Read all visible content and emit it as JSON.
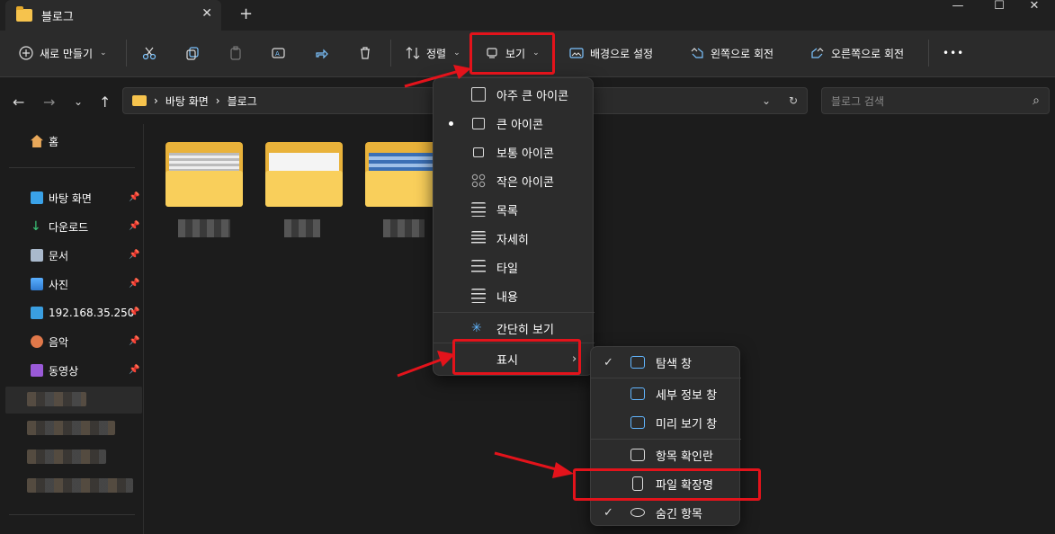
{
  "tab": {
    "title": "블로그",
    "close": "✕",
    "add": "+"
  },
  "window": {
    "minimize": "—",
    "maximize": "☐",
    "close": "✕"
  },
  "toolbar": {
    "new_label": "새로 만들기",
    "sort_label": "정렬",
    "view_label": "보기",
    "set_background": "배경으로 설정",
    "rotate_left": "왼쪽으로 회전",
    "rotate_right": "오른쪽으로 회전",
    "more": "•••"
  },
  "address": {
    "crumb1": "바탕 화면",
    "crumb2": "블로그"
  },
  "search": {
    "placeholder": "블로그 검색"
  },
  "sidebar": {
    "home": "홈",
    "items": [
      {
        "label": "바탕 화면"
      },
      {
        "label": "다운로드"
      },
      {
        "label": "문서"
      },
      {
        "label": "사진"
      },
      {
        "label": "192.168.35.250"
      },
      {
        "label": "음악"
      },
      {
        "label": "동영상"
      }
    ]
  },
  "view_menu": {
    "items": [
      {
        "label": "아주 큰 아이콘"
      },
      {
        "label": "큰 아이콘"
      },
      {
        "label": "보통 아이콘"
      },
      {
        "label": "작은 아이콘"
      },
      {
        "label": "목록"
      },
      {
        "label": "자세히"
      },
      {
        "label": "타일"
      },
      {
        "label": "내용"
      },
      {
        "label": "간단히 보기"
      },
      {
        "label": "표시"
      }
    ]
  },
  "show_submenu": {
    "items": [
      {
        "label": "탐색 창",
        "checked": true
      },
      {
        "label": "세부 정보 창",
        "checked": false
      },
      {
        "label": "미리 보기 창",
        "checked": false
      },
      {
        "label": "항목 확인란",
        "checked": false
      },
      {
        "label": "파일 확장명",
        "checked": false
      },
      {
        "label": "숨긴 항목",
        "checked": true
      }
    ]
  },
  "colors": {
    "highlight": "#e3131b",
    "accent": "#62b6ff",
    "folder": "#f6c34d"
  }
}
